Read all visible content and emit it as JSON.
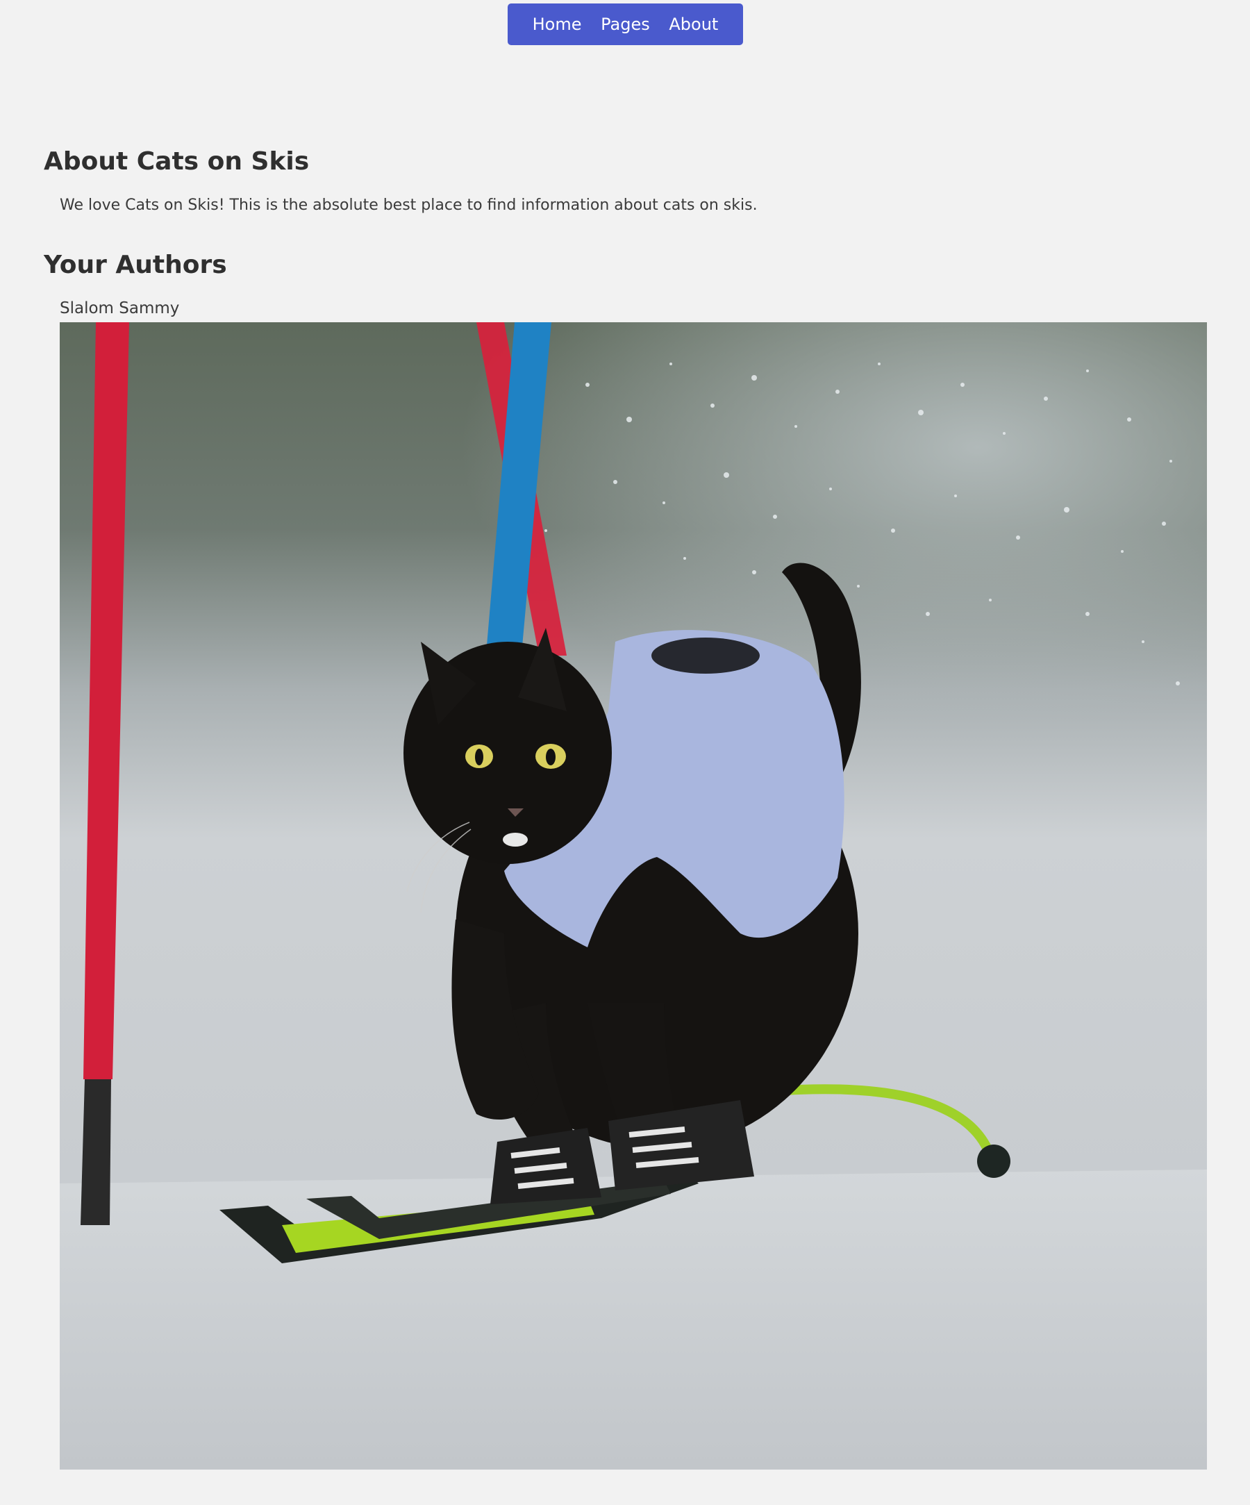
{
  "nav": {
    "items": [
      {
        "label": "Home"
      },
      {
        "label": "Pages"
      },
      {
        "label": "About"
      }
    ]
  },
  "about": {
    "title": "About Cats on Skis",
    "intro": "We love Cats on Skis! This is the absolute best place to find information about cats on skis."
  },
  "authors": {
    "title": "Your Authors",
    "list": [
      {
        "name": "Slalom Sammy",
        "photo_subject": "black cat skiing through slalom gates"
      }
    ]
  },
  "colors": {
    "page_background": "#f2f2f2",
    "nav_background": "#4a5acd",
    "nav_text": "#ffffff",
    "heading_text": "#2f2f2f",
    "body_text": "#3a3a3a"
  }
}
